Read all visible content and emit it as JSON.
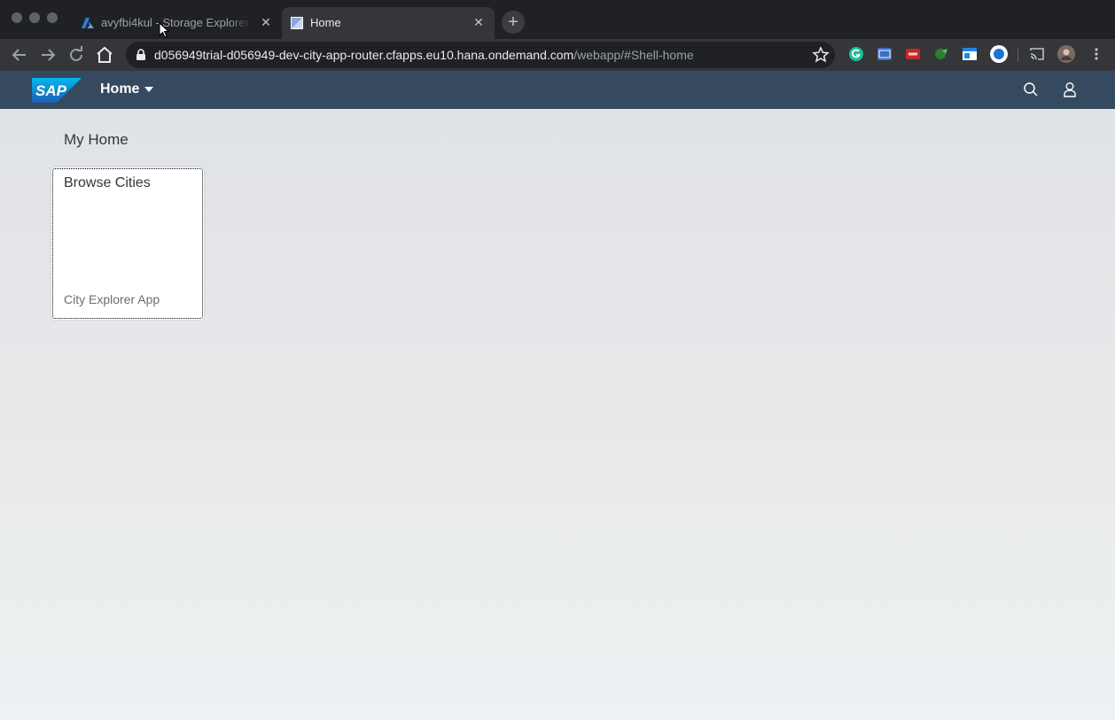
{
  "browser": {
    "tabs": [
      {
        "title": "avyfbi4kul - Storage Explorer (",
        "active": false
      },
      {
        "title": "Home",
        "active": true
      }
    ],
    "url": {
      "host": "d056949trial-d056949-dev-city-app-router.cfapps.eu10.hana.ondemand.com",
      "path": "/webapp/#Shell-home"
    },
    "extension_icons": [
      "grammarly-icon",
      "sass-icon",
      "cors-icon",
      "green-leaf-icon",
      "window-icon",
      "blue-circle-icon",
      "cast-icon",
      "profile-avatar"
    ]
  },
  "shell": {
    "logo": "SAP",
    "menu_label": "Home",
    "icons": [
      "search-icon",
      "user-icon"
    ],
    "bar_color": "#354a5f"
  },
  "page": {
    "section_title": "My Home",
    "tiles": [
      {
        "title": "Browse Cities",
        "subtitle": "City Explorer App"
      }
    ]
  }
}
